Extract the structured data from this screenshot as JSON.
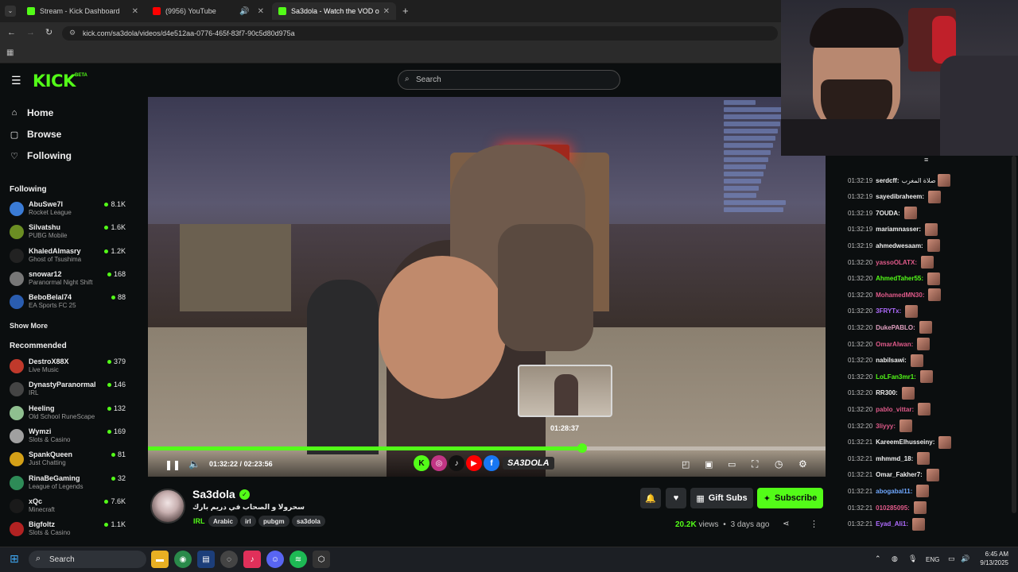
{
  "browser": {
    "tabs": [
      {
        "label": "Stream - Kick Dashboard",
        "favicon": "#53fc18"
      },
      {
        "label": "(9956) YouTube",
        "favicon": "#ff0000"
      },
      {
        "label": "Sa3dola - Watch the VOD o",
        "favicon": "#53fc18"
      }
    ],
    "url": "kick.com/sa3dola/videos/d4e512aa-0776-465f-83f7-90c5d80d975a"
  },
  "header": {
    "logo": "KICK",
    "beta": "BETA",
    "search_placeholder": "Search"
  },
  "sidebar": {
    "nav": [
      {
        "label": "Home",
        "icon": "home-icon"
      },
      {
        "label": "Browse",
        "icon": "browse-icon"
      },
      {
        "label": "Following",
        "icon": "heart-icon"
      }
    ],
    "following_title": "Following",
    "following": [
      {
        "name": "AbuSwe7l",
        "game": "Rocket League",
        "viewers": "8.1K",
        "color": "#3a7bd5"
      },
      {
        "name": "Silvatshu",
        "game": "PUBG Mobile",
        "viewers": "1.6K",
        "color": "#6b8e23"
      },
      {
        "name": "KhaledAlmasry",
        "game": "Ghost of Tsushima",
        "viewers": "1.2K",
        "color": "#222222"
      },
      {
        "name": "snowar12",
        "game": "Paranormal Night Shift",
        "viewers": "168",
        "color": "#777777"
      },
      {
        "name": "BeboBelal74",
        "game": "EA Sports FC 25",
        "viewers": "88",
        "color": "#2a5db0"
      }
    ],
    "show_more": "Show More",
    "recommended_title": "Recommended",
    "recommended": [
      {
        "name": "DestroX88X",
        "game": "Live Music",
        "viewers": "379",
        "color": "#c0392b"
      },
      {
        "name": "DynastyParanormal",
        "game": "IRL",
        "viewers": "146",
        "color": "#444444"
      },
      {
        "name": "Heeling",
        "game": "Old School RuneScape",
        "viewers": "132",
        "color": "#8fbf8f"
      },
      {
        "name": "Wymzi",
        "game": "Slots & Casino",
        "viewers": "169",
        "color": "#a0a0a0"
      },
      {
        "name": "SpankQueen",
        "game": "Just Chatting",
        "viewers": "81",
        "color": "#d4a017"
      },
      {
        "name": "RinaBeGaming",
        "game": "League of Legends",
        "viewers": "32",
        "color": "#2e8b57"
      },
      {
        "name": "xQc",
        "game": "Minecraft",
        "viewers": "7.6K",
        "color": "#1a1a1a"
      },
      {
        "name": "Bigfoltz",
        "game": "Slots & Casino",
        "viewers": "1.1K",
        "color": "#b22222"
      }
    ]
  },
  "player": {
    "current_time": "01:32:22",
    "separator": "/",
    "duration": "02:23:56",
    "progress": 0.641,
    "preview_time": "01:28:37",
    "brand_tag": "SA3DOLA"
  },
  "chat": {
    "messages": [
      {
        "time": "01:32:19",
        "user": "serdcff:",
        "text": "صلاة المغرب",
        "color": "#f0f0f0"
      },
      {
        "time": "01:32:19",
        "user": "sayedibraheem:",
        "text": "",
        "color": "#f0f0f0"
      },
      {
        "time": "01:32:19",
        "user": "7OUDA:",
        "text": "",
        "color": "#f0f0f0"
      },
      {
        "time": "01:32:19",
        "user": "mariamnasser:",
        "text": "",
        "color": "#f0f0f0"
      },
      {
        "time": "01:32:19",
        "user": "ahmedwesaam:",
        "text": "",
        "color": "#f0f0f0"
      },
      {
        "time": "01:32:20",
        "user": "yassoOLATX:",
        "text": "",
        "color": "#e05a8a"
      },
      {
        "time": "01:32:20",
        "user": "AhmedTaher55:",
        "text": "",
        "color": "#53fc18"
      },
      {
        "time": "01:32:20",
        "user": "MohamedMN30:",
        "text": "",
        "color": "#e05a8a"
      },
      {
        "time": "01:32:20",
        "user": "3FRYTx:",
        "text": "",
        "color": "#b06cff"
      },
      {
        "time": "01:32:20",
        "user": "DukePABLO:",
        "text": "",
        "color": "#e0a0c0"
      },
      {
        "time": "01:32:20",
        "user": "OmarAlwan:",
        "text": "",
        "color": "#e05a8a"
      },
      {
        "time": "01:32:20",
        "user": "nabilsawi:",
        "text": "",
        "color": "#f0f0f0"
      },
      {
        "time": "01:32:20",
        "user": "LoLFan3mr1:",
        "text": "",
        "color": "#53fc18"
      },
      {
        "time": "01:32:20",
        "user": "RR300:",
        "text": "",
        "color": "#f0f0f0"
      },
      {
        "time": "01:32:20",
        "user": "pablo_vittar:",
        "text": "",
        "color": "#e05a8a"
      },
      {
        "time": "01:32:20",
        "user": "3liyyy:",
        "text": "",
        "color": "#e05a8a"
      },
      {
        "time": "01:32:21",
        "user": "KareemElhusseiny:",
        "text": "",
        "color": "#f0f0f0"
      },
      {
        "time": "01:32:21",
        "user": "mhmmd_18:",
        "text": "",
        "color": "#f0f0f0"
      },
      {
        "time": "01:32:21",
        "user": "Omar_Fakher7:",
        "text": "",
        "color": "#f0f0f0"
      },
      {
        "time": "01:32:21",
        "user": "abogabal11:",
        "text": "",
        "color": "#6fa8ff"
      },
      {
        "time": "01:32:21",
        "user": "010285095:",
        "text": "",
        "color": "#e05a8a"
      },
      {
        "time": "01:32:21",
        "user": "Eyad_Ali1:",
        "text": "",
        "color": "#b06cff"
      }
    ]
  },
  "channel": {
    "name": "Sa3dola",
    "title": "سحرولا و الصحاب في دريم بارك",
    "category": "IRL",
    "tags": [
      "Arabic",
      "irl",
      "pubgm",
      "sa3dola"
    ],
    "gift_label": "Gift Subs",
    "subscribe_label": "Subscribe",
    "views": "20.2K",
    "views_suffix": "views",
    "bullet": "•",
    "date": "3 days ago"
  },
  "taskbar": {
    "search": "Search",
    "lang": "ENG",
    "time": "6:45 AM",
    "date": "9/13/2025"
  },
  "colors": {
    "accent": "#53fc18",
    "background": "#0b0e0f"
  }
}
